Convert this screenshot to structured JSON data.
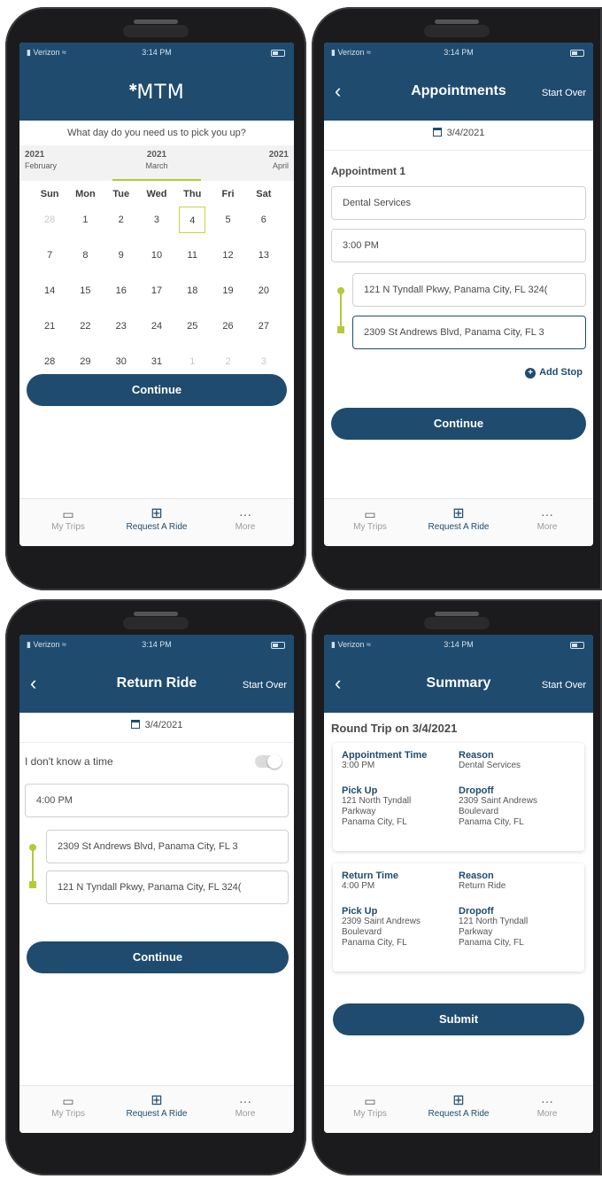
{
  "status": {
    "carrier": "Verizon",
    "time": "3:14 PM"
  },
  "colors": {
    "primary": "#1f4b6e",
    "accent": "#b7c83a",
    "background": "#ffffff"
  },
  "tabs": [
    {
      "label": "My Trips",
      "icon": "car-icon"
    },
    {
      "label": "Request A Ride",
      "icon": "plus-square-icon",
      "active": true
    },
    {
      "label": "More",
      "icon": "more-dots-icon"
    }
  ],
  "screen1": {
    "logo": "MTM",
    "question": "What day do you need us to pick you up?",
    "months": [
      {
        "year": "2021",
        "name": "February"
      },
      {
        "year": "2021",
        "name": "March",
        "selected": true
      },
      {
        "year": "2021",
        "name": "April"
      }
    ],
    "weekdays": [
      "Sun",
      "Mon",
      "Tue",
      "Wed",
      "Thu",
      "Fri",
      "Sat"
    ],
    "weeks": [
      [
        "28",
        "1",
        "2",
        "3",
        "4",
        "5",
        "6"
      ],
      [
        "7",
        "8",
        "9",
        "10",
        "11",
        "12",
        "13"
      ],
      [
        "14",
        "15",
        "16",
        "17",
        "18",
        "19",
        "20"
      ],
      [
        "21",
        "22",
        "23",
        "24",
        "25",
        "26",
        "27"
      ],
      [
        "28",
        "29",
        "30",
        "31",
        "1",
        "2",
        "3"
      ]
    ],
    "selected_day": "4",
    "continue": "Continue"
  },
  "screen2": {
    "title": "Appointments",
    "start_over": "Start Over",
    "date": "3/4/2021",
    "appointment_label": "Appointment 1",
    "reason": "Dental Services",
    "time": "3:00 PM",
    "pickup": "121 N Tyndall Pkwy, Panama City, FL 324(",
    "dropoff": "2309 St Andrews Blvd, Panama City, FL 3",
    "add_stop": "Add Stop",
    "continue": "Continue"
  },
  "screen3": {
    "title": "Return Ride",
    "start_over": "Start Over",
    "date": "3/4/2021",
    "dont_know": "I don't know a time",
    "time": "4:00 PM",
    "pickup": "2309 St Andrews Blvd, Panama City, FL 3",
    "dropoff": "121 N Tyndall Pkwy, Panama City, FL 324(",
    "continue": "Continue"
  },
  "screen4": {
    "title": "Summary",
    "start_over": "Start Over",
    "heading": "Round Trip on 3/4/2021",
    "card1": {
      "time_label": "Appointment Time",
      "time": "3:00 PM",
      "reason_label": "Reason",
      "reason": "Dental Services",
      "pickup_label": "Pick Up",
      "pickup_1": "121 North Tyndall",
      "pickup_2": "Parkway",
      "pickup_3": "Panama City, FL",
      "dropoff_label": "Dropoff",
      "dropoff_1": "2309 Saint Andrews",
      "dropoff_2": "Boulevard",
      "dropoff_3": "Panama City, FL"
    },
    "card2": {
      "time_label": "Return Time",
      "time": "4:00 PM",
      "reason_label": "Reason",
      "reason": "Return Ride",
      "pickup_label": "Pick Up",
      "pickup_1": "2309 Saint Andrews",
      "pickup_2": "Boulevard",
      "pickup_3": "Panama City, FL",
      "dropoff_label": "Dropoff",
      "dropoff_1": "121 North Tyndall",
      "dropoff_2": "Parkway",
      "dropoff_3": "Panama City, FL"
    },
    "submit": "Submit"
  }
}
